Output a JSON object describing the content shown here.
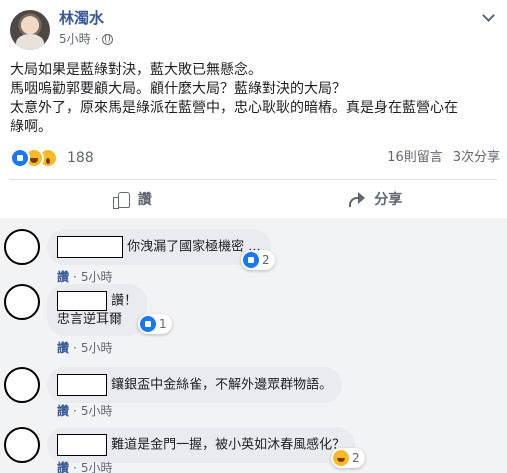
{
  "post": {
    "author": "林濁水",
    "time": "5小時",
    "lines": [
      "大局如果是藍綠對決，藍大敗已無懸念。",
      "馬咽嗚勸郭要顧大局。顧什麼大局？藍綠對決的大局？",
      "太意外了，原來馬是綠派在藍營中，忠心耿耿的暗樁。真是身在藍營心在",
      "綠啊。"
    ]
  },
  "reactions": {
    "count": "188",
    "comments_count": "16則留言",
    "shares_count": "3次分享",
    "icons": [
      "like-icon",
      "haha-icon",
      "wow-icon"
    ]
  },
  "actions": {
    "like_label": "讚",
    "share_label": "分享"
  },
  "comments": [
    {
      "text": "你洩漏了國家極機密 ...",
      "reply_label": "讚",
      "time": "5小時",
      "reaction_count": "2",
      "reaction_icon": "like-icon"
    },
    {
      "text_line1": "讚！",
      "text_line2": "忠言逆耳爾",
      "reply_label": "讚",
      "time": "5小時",
      "reaction_count": "1",
      "reaction_icon": "like-icon"
    },
    {
      "text": "鑲銀盃中金絲雀，不解外邊眾群物語。",
      "reply_label": "讚",
      "time": "5小時"
    },
    {
      "text": "難道是金門一握，被小英如沐春風感化？",
      "reply_label": "讚",
      "time": "5小時",
      "reaction_count": "2",
      "reaction_icon": "haha-icon"
    }
  ]
}
